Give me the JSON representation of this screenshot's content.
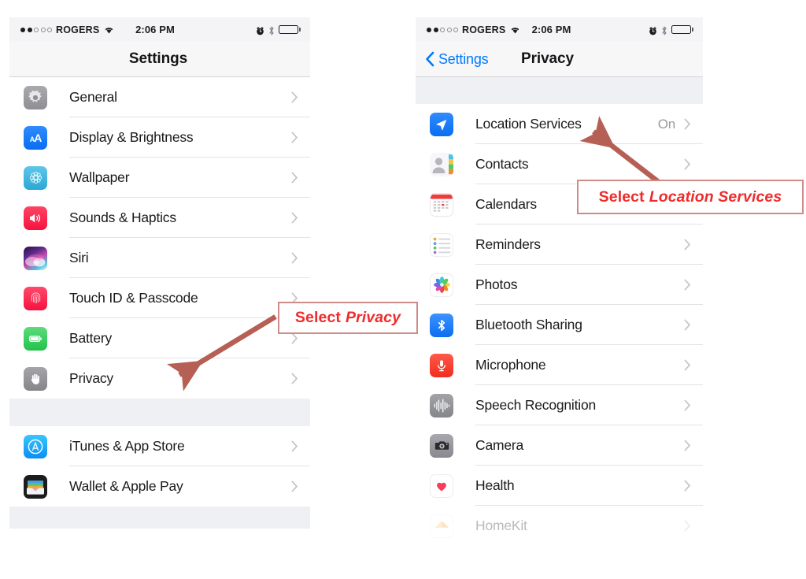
{
  "status_bar": {
    "carrier": "ROGERS",
    "signal_dots_filled": 2,
    "signal_dots_total": 5,
    "wifi_icon": "wifi-icon",
    "time": "2:06 PM",
    "alarm_icon": "alarm-clock-icon",
    "bluetooth_icon": "bluetooth-icon",
    "battery_icon": "battery-icon"
  },
  "left_phone": {
    "nav": {
      "title": "Settings"
    },
    "sections": [
      {
        "rows": [
          {
            "label": "General",
            "icon": "gear-icon",
            "value": "",
            "chevron": "chevron-right-icon"
          },
          {
            "label": "Display & Brightness",
            "icon": "display-aa-icon",
            "value": "",
            "chevron": "chevron-right-icon"
          },
          {
            "label": "Wallpaper",
            "icon": "wallpaper-icon",
            "value": "",
            "chevron": "chevron-right-icon"
          },
          {
            "label": "Sounds & Haptics",
            "icon": "speaker-icon",
            "value": "",
            "chevron": "chevron-right-icon"
          },
          {
            "label": "Siri",
            "icon": "siri-icon",
            "value": "",
            "chevron": "chevron-right-icon"
          },
          {
            "label": "Touch ID & Passcode",
            "icon": "fingerprint-icon",
            "value": "",
            "chevron": "chevron-right-icon"
          },
          {
            "label": "Battery",
            "icon": "battery-icon",
            "value": "",
            "chevron": "chevron-right-icon"
          },
          {
            "label": "Privacy",
            "icon": "hand-icon",
            "value": "",
            "chevron": "chevron-right-icon"
          }
        ]
      },
      {
        "rows": [
          {
            "label": "iTunes & App Store",
            "icon": "app-store-icon",
            "value": "",
            "chevron": "chevron-right-icon"
          },
          {
            "label": "Wallet & Apple Pay",
            "icon": "wallet-icon",
            "value": "",
            "chevron": "chevron-right-icon"
          }
        ]
      }
    ]
  },
  "right_phone": {
    "nav": {
      "back_label": "Settings",
      "back_icon": "chevron-left-icon",
      "title": "Privacy"
    },
    "sections": [
      {
        "rows": [
          {
            "label": "Location Services",
            "icon": "location-arrow-icon",
            "value": "On",
            "chevron": "chevron-right-icon"
          },
          {
            "label": "Contacts",
            "icon": "contacts-icon",
            "value": "",
            "chevron": "chevron-right-icon"
          },
          {
            "label": "Calendars",
            "icon": "calendar-icon",
            "value": "",
            "chevron": "chevron-right-icon"
          },
          {
            "label": "Reminders",
            "icon": "reminders-icon",
            "value": "",
            "chevron": "chevron-right-icon"
          },
          {
            "label": "Photos",
            "icon": "photos-icon",
            "value": "",
            "chevron": "chevron-right-icon"
          },
          {
            "label": "Bluetooth Sharing",
            "icon": "bluetooth-icon",
            "value": "",
            "chevron": "chevron-right-icon"
          },
          {
            "label": "Microphone",
            "icon": "microphone-icon",
            "value": "",
            "chevron": "chevron-right-icon"
          },
          {
            "label": "Speech Recognition",
            "icon": "waveform-icon",
            "value": "",
            "chevron": "chevron-right-icon"
          },
          {
            "label": "Camera",
            "icon": "camera-icon",
            "value": "",
            "chevron": "chevron-right-icon"
          },
          {
            "label": "Health",
            "icon": "heart-icon",
            "value": "",
            "chevron": "chevron-right-icon"
          },
          {
            "label": "HomeKit",
            "icon": "home-icon",
            "value": "",
            "chevron": "chevron-right-icon"
          }
        ]
      }
    ]
  },
  "annotations": [
    {
      "prefix": "Select",
      "emphasis": "Privacy",
      "target": "Privacy row (left phone)"
    },
    {
      "prefix": "Select",
      "emphasis": "Location Services",
      "target": "Location Services row (right phone)"
    }
  ],
  "colors": {
    "callout_text": "#ef2b2b",
    "callout_border": "#cf8b85",
    "arrow": "#b55f55",
    "ios_blue": "#007aff",
    "section_gap": "#eff0f4",
    "separator": "#e3e3e6"
  }
}
